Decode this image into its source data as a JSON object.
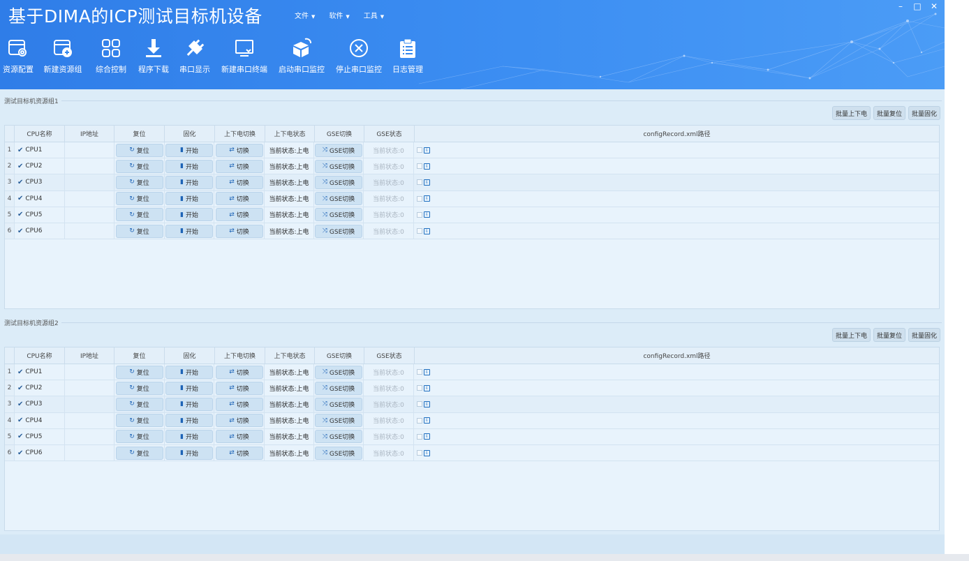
{
  "window": {
    "title": "基于DIMA的ICP测试目标机设备",
    "controls": [
      "–",
      "□",
      "✕"
    ]
  },
  "menus": [
    {
      "label": "文件"
    },
    {
      "label": "软件"
    },
    {
      "label": "工具"
    }
  ],
  "toolbar": [
    {
      "label": "资源配置",
      "icon": "resource-config-icon"
    },
    {
      "label": "新建资源组",
      "icon": "new-group-icon"
    },
    {
      "label": "综合控制",
      "icon": "grid-control-icon"
    },
    {
      "label": "程序下载",
      "icon": "download-icon"
    },
    {
      "label": "串口显示",
      "icon": "plug-icon"
    },
    {
      "label": "新建串口终端",
      "icon": "terminal-icon"
    },
    {
      "label": "启动串口监控",
      "icon": "cube-icon"
    },
    {
      "label": "停止串口监控",
      "icon": "stop-icon"
    },
    {
      "label": "日志管理",
      "icon": "clipboard-icon"
    }
  ],
  "batch_buttons": [
    "批量上下电",
    "批量复位",
    "批量固化"
  ],
  "columns": [
    "CPU名称",
    "IP地址",
    "复位",
    "固化",
    "上下电切换",
    "上下电状态",
    "GSE切换",
    "GSE状态",
    "configRecord.xml路径"
  ],
  "actions": {
    "reset": "复位",
    "solidify": "开始",
    "power": "切换",
    "gse": "GSE切换"
  },
  "groups": [
    {
      "title": "测试目标机资源组1",
      "rows": [
        {
          "idx": "1",
          "cpu": "CPU1",
          "ip": "",
          "power_state": "当前状态:上电",
          "gse_state": "当前状态:0"
        },
        {
          "idx": "2",
          "cpu": "CPU2",
          "ip": "",
          "power_state": "当前状态:上电",
          "gse_state": "当前状态:0"
        },
        {
          "idx": "3",
          "cpu": "CPU3",
          "ip": "",
          "power_state": "当前状态:上电",
          "gse_state": "当前状态:0"
        },
        {
          "idx": "4",
          "cpu": "CPU4",
          "ip": "",
          "power_state": "当前状态:上电",
          "gse_state": "当前状态:0"
        },
        {
          "idx": "5",
          "cpu": "CPU5",
          "ip": "",
          "power_state": "当前状态:上电",
          "gse_state": "当前状态:0"
        },
        {
          "idx": "6",
          "cpu": "CPU6",
          "ip": "",
          "power_state": "当前状态:上电",
          "gse_state": "当前状态:0"
        }
      ]
    },
    {
      "title": "测试目标机资源组2",
      "rows": [
        {
          "idx": "1",
          "cpu": "CPU1",
          "ip": "",
          "power_state": "当前状态:上电",
          "gse_state": "当前状态:0"
        },
        {
          "idx": "2",
          "cpu": "CPU2",
          "ip": "",
          "power_state": "当前状态:上电",
          "gse_state": "当前状态:0"
        },
        {
          "idx": "3",
          "cpu": "CPU3",
          "ip": "",
          "power_state": "当前状态:上电",
          "gse_state": "当前状态:0"
        },
        {
          "idx": "4",
          "cpu": "CPU4",
          "ip": "",
          "power_state": "当前状态:上电",
          "gse_state": "当前状态:0"
        },
        {
          "idx": "5",
          "cpu": "CPU5",
          "ip": "",
          "power_state": "当前状态:上电",
          "gse_state": "当前状态:0"
        },
        {
          "idx": "6",
          "cpu": "CPU6",
          "ip": "",
          "power_state": "当前状态:上电",
          "gse_state": "当前状态:0"
        }
      ]
    }
  ],
  "colors": {
    "header": "#3588ee",
    "panel": "#dcecf8",
    "accent": "#1d63b6"
  }
}
